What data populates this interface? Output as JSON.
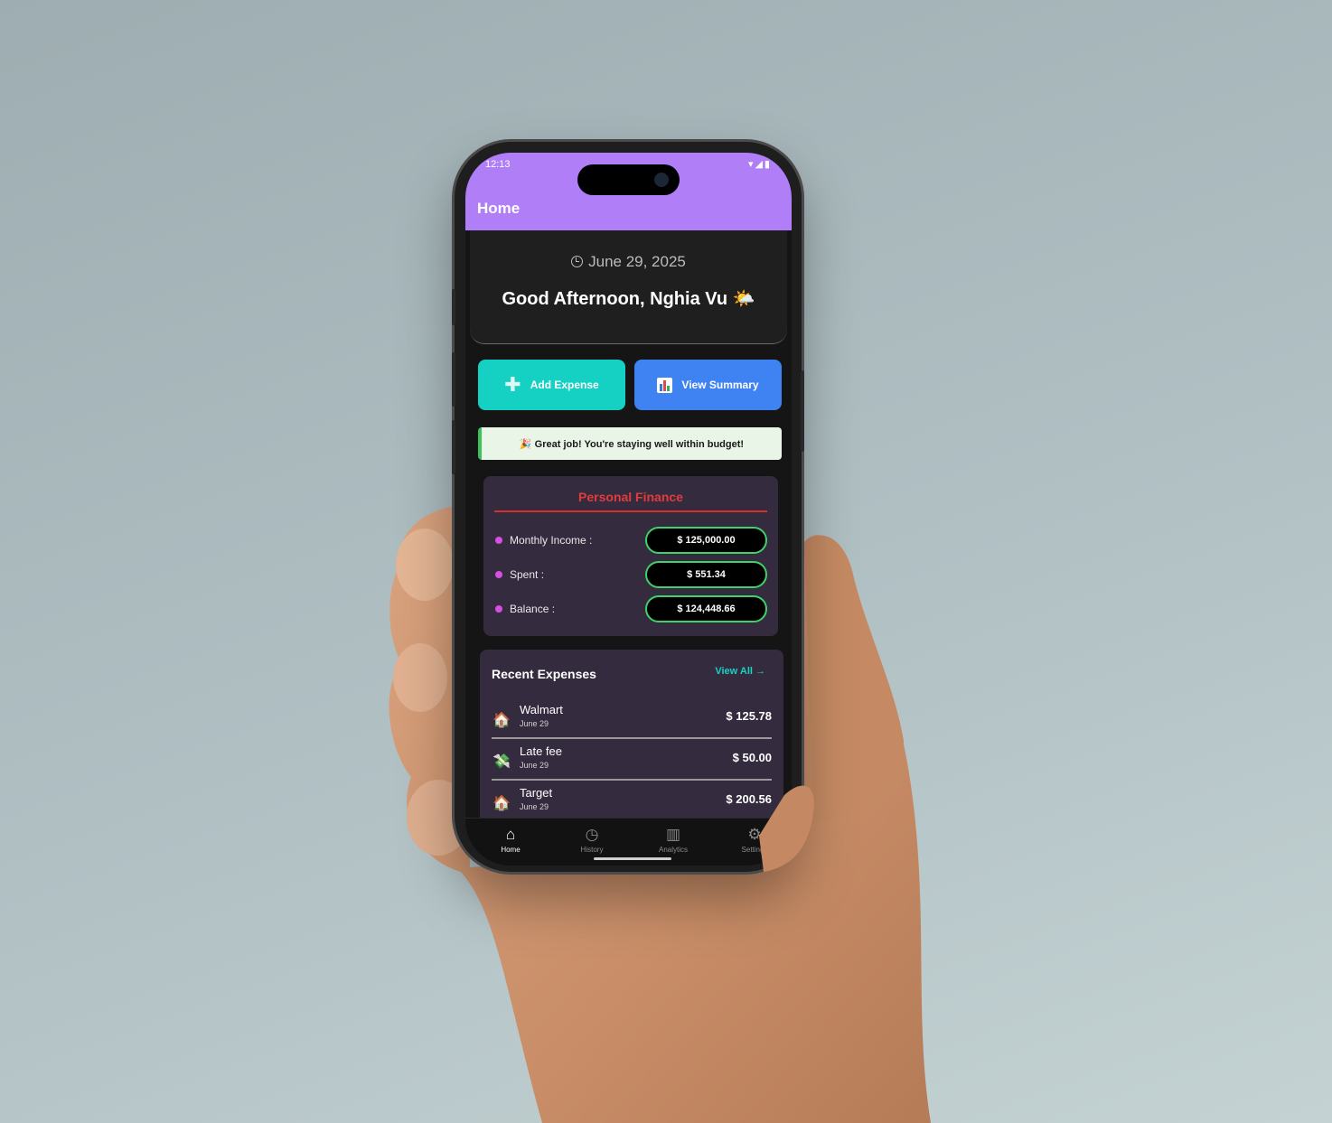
{
  "statusbar": {
    "time": "12:13"
  },
  "appbar": {
    "title": "Home"
  },
  "greeting": {
    "date": "June 29, 2025",
    "message": "Good Afternoon, Nghia Vu 🌤️"
  },
  "actions": {
    "add_label": "Add Expense",
    "summary_label": "View Summary"
  },
  "banner": {
    "text": "🎉 Great job! You're staying well within budget!"
  },
  "finance": {
    "title": "Personal Finance",
    "rows": [
      {
        "label": "Monthly Income :",
        "value": "$ 125,000.00"
      },
      {
        "label": "Spent :",
        "value": "$ 551.34"
      },
      {
        "label": "Balance :",
        "value": "$ 124,448.66"
      }
    ]
  },
  "recent": {
    "title": "Recent Expenses",
    "view_all": "View All →",
    "items": [
      {
        "icon": "house-icon",
        "name": "Walmart",
        "date": "June 29",
        "amount": "$ 125.78"
      },
      {
        "icon": "money-icon",
        "name": "Late fee",
        "date": "June 29",
        "amount": "$ 50.00"
      },
      {
        "icon": "house-icon",
        "name": "Target",
        "date": "June 29",
        "amount": "$ 200.56"
      }
    ]
  },
  "tabs": [
    {
      "label": "Home",
      "icon": "home-icon"
    },
    {
      "label": "History",
      "icon": "clock-icon"
    },
    {
      "label": "Analytics",
      "icon": "bar-chart-icon"
    },
    {
      "label": "Settings",
      "icon": "gear-icon"
    }
  ],
  "colors": {
    "appbar": "#b07ef7",
    "add_button": "#14d1c3",
    "summary_button": "#3f82f2",
    "finance_title": "#e23b3b",
    "pill_border": "#3fd16a",
    "card_bg": "#352b3e"
  }
}
